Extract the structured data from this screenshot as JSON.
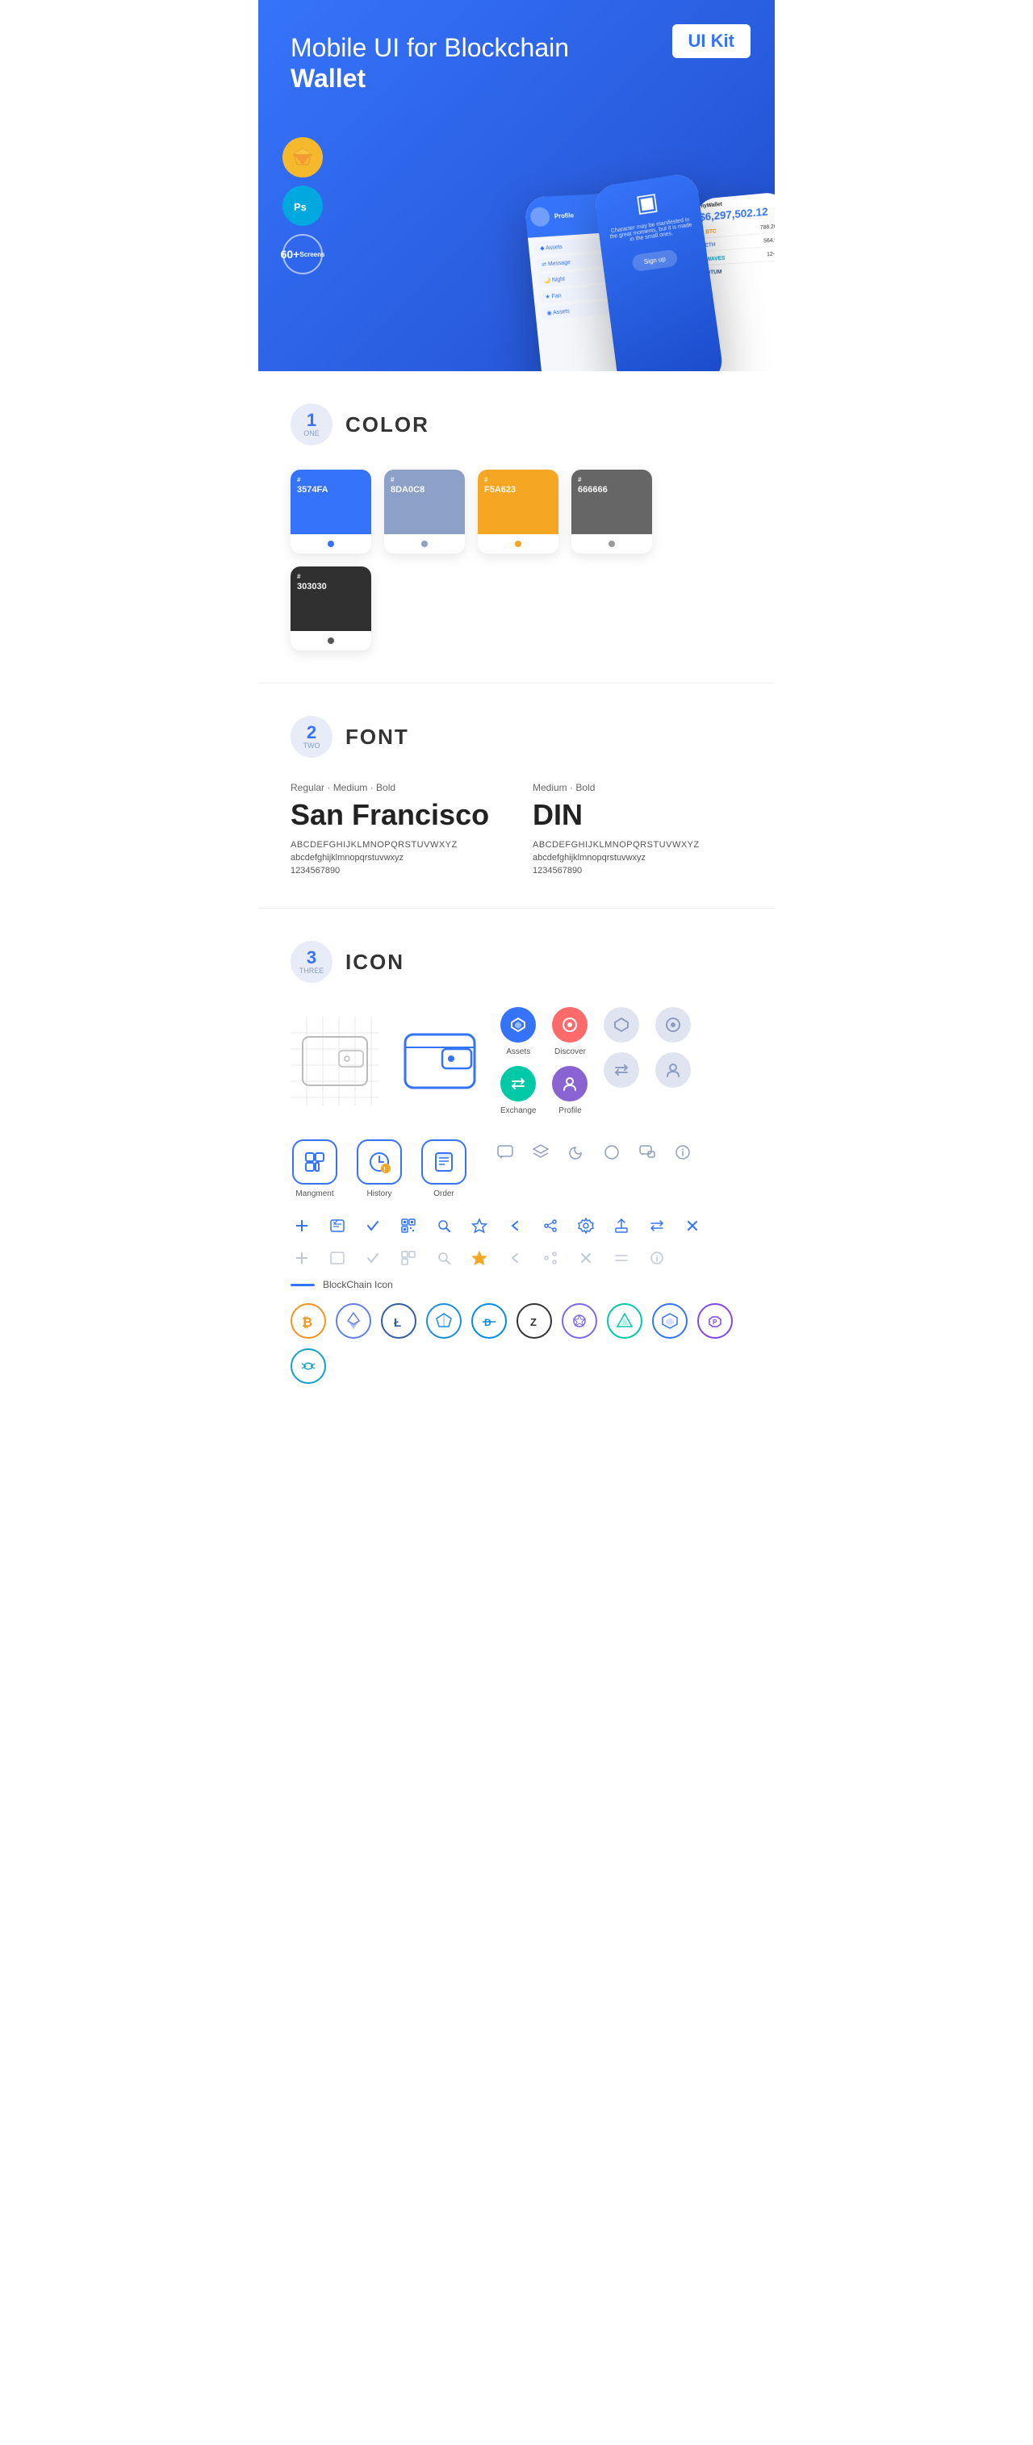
{
  "hero": {
    "title_normal": "Mobile UI for Blockchain ",
    "title_bold": "Wallet",
    "badge": "UI Kit",
    "badges": [
      {
        "id": "sketch",
        "label": "S",
        "type": "sketch"
      },
      {
        "id": "ps",
        "label": "Ps",
        "type": "ps"
      },
      {
        "id": "screens",
        "count": "60+",
        "sub": "Screens",
        "type": "screens"
      }
    ]
  },
  "sections": {
    "color": {
      "number": "1",
      "label": "ONE",
      "title": "COLOR",
      "swatches": [
        {
          "hex": "#3574FA",
          "code": "3574FA",
          "dot": "#3574FA"
        },
        {
          "hex": "#8DA0C8",
          "code": "8DA0C8",
          "dot": "#8DA0C8"
        },
        {
          "hex": "#F5A623",
          "code": "F5A623",
          "dot": "#F5A623"
        },
        {
          "hex": "#666666",
          "code": "666666",
          "dot": "#666666"
        },
        {
          "hex": "#303030",
          "code": "303030",
          "dot": "#303030"
        }
      ]
    },
    "font": {
      "number": "2",
      "label": "TWO",
      "title": "FONT",
      "fonts": [
        {
          "style": "Regular · Medium · Bold",
          "name": "San Francisco",
          "uppercase": "ABCDEFGHIJKLMNOPQRSTUVWXYZ",
          "lowercase": "abcdefghijklmnopqrstuvwxyz",
          "numbers": "1234567890"
        },
        {
          "style": "Medium · Bold",
          "name": "DIN",
          "uppercase": "ABCDEFGHIJKLMNOPQRSTUVWXYZ",
          "lowercase": "abcdefghijklmnopqrstuvwxyz",
          "numbers": "1234567890"
        }
      ]
    },
    "icon": {
      "number": "3",
      "label": "THREE",
      "title": "ICON",
      "nav_icons": [
        {
          "label": "Assets",
          "symbol": "◆"
        },
        {
          "label": "Exchange",
          "symbol": "⇄"
        },
        {
          "label": "Discover",
          "symbol": "◉"
        },
        {
          "label": "Profile",
          "symbol": "⌀"
        }
      ],
      "app_icons": [
        {
          "label": "Mangment",
          "type": "management"
        },
        {
          "label": "History",
          "type": "history"
        },
        {
          "label": "Order",
          "type": "order"
        }
      ],
      "blockchain_label": "BlockChain Icon",
      "blockchain_icons": [
        {
          "symbol": "₿",
          "color": "#F7931A",
          "bg": "#fff",
          "border": "#F7931A",
          "name": "bitcoin"
        },
        {
          "symbol": "Ξ",
          "color": "#627EEA",
          "bg": "#fff",
          "border": "#627EEA",
          "name": "ethereum"
        },
        {
          "symbol": "Ł",
          "color": "#345D9D",
          "bg": "#fff",
          "border": "#345D9D",
          "name": "litecoin"
        },
        {
          "symbol": "◆",
          "color": "#1B8DDD",
          "bg": "#fff",
          "border": "#1B8DDD",
          "name": "stratis"
        },
        {
          "symbol": "D",
          "color": "#008CE7",
          "bg": "#fff",
          "border": "#008CE7",
          "name": "dash"
        },
        {
          "symbol": "Z",
          "color": "#333",
          "bg": "#fff",
          "border": "#333",
          "name": "zcash"
        },
        {
          "symbol": "✦",
          "color": "#7B68EE",
          "bg": "#fff",
          "border": "#7B68EE",
          "name": "stellar"
        },
        {
          "symbol": "▲",
          "color": "#00C9A7",
          "bg": "#fff",
          "border": "#00C9A7",
          "name": "waves"
        },
        {
          "symbol": "◈",
          "color": "#3574FA",
          "bg": "#fff",
          "border": "#3574FA",
          "name": "vechain"
        },
        {
          "symbol": "⬡",
          "color": "#8247E5",
          "bg": "#fff",
          "border": "#8247E5",
          "name": "polygon"
        },
        {
          "symbol": "~",
          "color": "#0FA0CE",
          "bg": "#fff",
          "border": "#0FA0CE",
          "name": "ripple"
        }
      ]
    }
  }
}
